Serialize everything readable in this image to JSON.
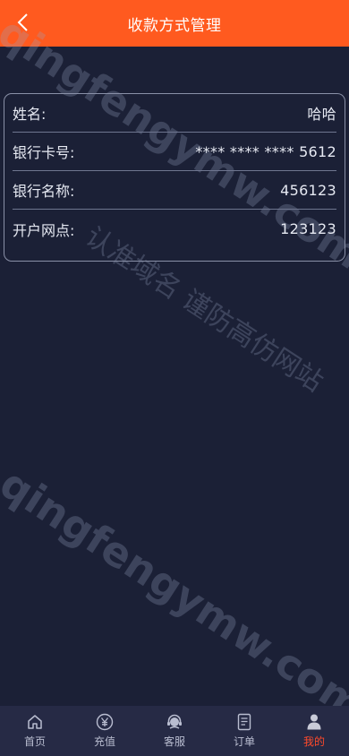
{
  "header": {
    "title": "收款方式管理"
  },
  "account": {
    "rows": [
      {
        "label": "姓名:",
        "value": "哈哈"
      },
      {
        "label": "银行卡号:",
        "value": "**** **** **** 5612"
      },
      {
        "label": "银行名称:",
        "value": "456123"
      },
      {
        "label": "开户网点:",
        "value": "123123"
      }
    ]
  },
  "watermark": {
    "line1": "qingfengymw.com",
    "line2": "认准域名 谨防高仿网站",
    "line3": "qingfengymw.com"
  },
  "tabbar": {
    "items": [
      {
        "label": "首页",
        "icon": "home-icon"
      },
      {
        "label": "充值",
        "icon": "yen-icon"
      },
      {
        "label": "客服",
        "icon": "headset-icon"
      },
      {
        "label": "订单",
        "icon": "order-icon"
      },
      {
        "label": "我的",
        "icon": "user-icon",
        "active": true
      }
    ],
    "active_color": "#ff4a2b"
  },
  "colors": {
    "header": "#ff5a1f",
    "background": "#1b2036"
  }
}
